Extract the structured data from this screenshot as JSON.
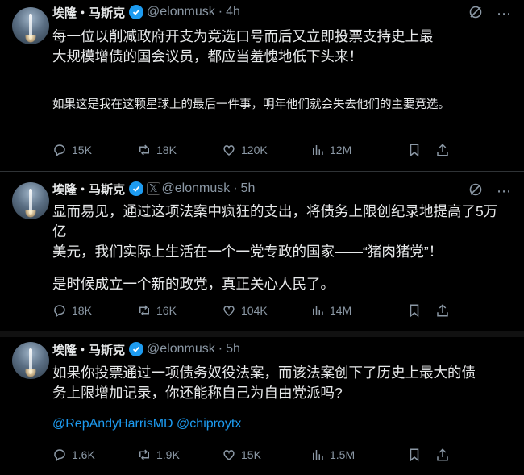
{
  "tweets": [
    {
      "author_name": "埃隆・马斯克",
      "handle": "@elonmusk",
      "time": "4h",
      "x_badge": "",
      "text_main": "每一位以削减政府开支为竞选口号而后又立即投票支持史上最大规模增债的国会议员，都应当羞愧地低下头来！",
      "text_line1": "每一位以削减政府开支为竞选口号而后又立即投票支持史上最",
      "text_line2": "大规模增债的国会议员，都应当羞愧地低下头来！",
      "text_secondary": "如果这是我在这颗星球上的最后一件事，明年他们就会失去他们的主要竞选。",
      "replies": "15K",
      "reposts": "18K",
      "likes": "120K",
      "views": "12M"
    },
    {
      "author_name": "埃隆・马斯克",
      "handle": "@elonmusk",
      "time": "5h",
      "x_badge": "𝕏",
      "text_line1": "显而易见，通过这项法案中疯狂的支出，将债务上限创纪录地提高了5万亿",
      "text_line2": "美元，我们实际上生活在一个一党专政的国家——“猪肉猪党”！",
      "text_secondary": "是时候成立一个新的政党，真正关心人民了。",
      "replies": "18K",
      "reposts": "16K",
      "likes": "104K",
      "views": "14M"
    },
    {
      "author_name": "埃隆・马斯克",
      "handle": "@elonmusk",
      "time": "5h",
      "x_badge": "",
      "text_line1": "如果你投票通过一项债务奴役法案，而该法案创下了历史上最大的债",
      "text_line2": "务上限增加记录，你还能称自己为自由党派吗?",
      "mentions": "@RepAndyHarrisMD @chiproytx",
      "replies": "1.6K",
      "reposts": "1.9K",
      "likes": "15K",
      "views": "1.5M"
    }
  ],
  "icons": [
    "grok-icon",
    "more-icon",
    "reply-icon",
    "repost-icon",
    "like-icon",
    "views-icon",
    "bookmark-icon",
    "share-icon",
    "verified-icon",
    "avatar-image"
  ],
  "colors": {
    "background": "#000000",
    "text": "#e7e9ea",
    "muted": "#8b98a5",
    "accent": "#1d9bf0"
  }
}
